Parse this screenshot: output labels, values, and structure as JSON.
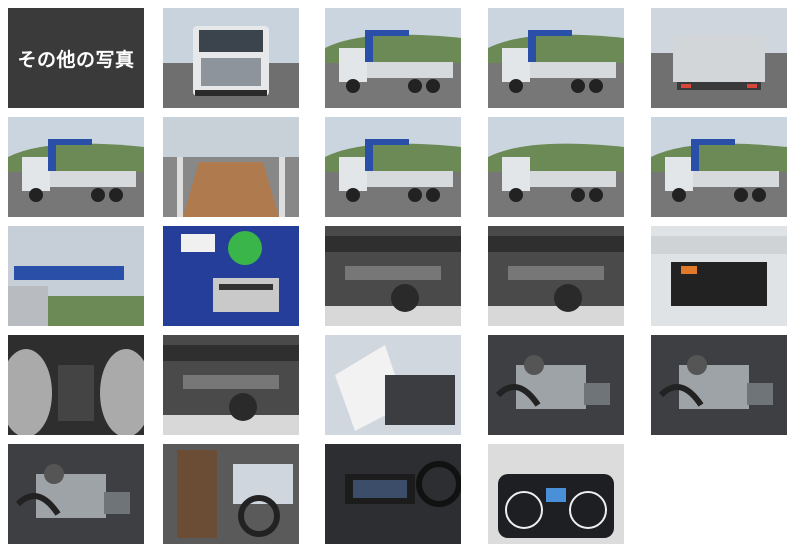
{
  "gallery": {
    "title": "その他の写真",
    "photos": [
      {
        "subject": "truck-front"
      },
      {
        "subject": "truck-front-left-crane"
      },
      {
        "subject": "truck-side-rear-crane"
      },
      {
        "subject": "truck-rear"
      },
      {
        "subject": "truck-side-crane-folded"
      },
      {
        "subject": "cargo-bed-floor"
      },
      {
        "subject": "truck-front-left-crane-2"
      },
      {
        "subject": "truck-rear-right"
      },
      {
        "subject": "crane-extended-side"
      },
      {
        "subject": "crane-arm-closeup"
      },
      {
        "subject": "tadano-plate"
      },
      {
        "subject": "undercarriage-1"
      },
      {
        "subject": "undercarriage-2"
      },
      {
        "subject": "rear-light-bumper"
      },
      {
        "subject": "rear-axle-tires"
      },
      {
        "subject": "underbody-suspension"
      },
      {
        "subject": "cab-tilted"
      },
      {
        "subject": "engine-1"
      },
      {
        "subject": "engine-2"
      },
      {
        "subject": "engine-3"
      },
      {
        "subject": "driver-seat"
      },
      {
        "subject": "dashboard-center"
      },
      {
        "subject": "instrument-cluster"
      }
    ]
  },
  "colors": {
    "label_bg": "#3a3a3a",
    "crane_blue": "#2a4fa8",
    "truck_white": "#e9ecef"
  }
}
